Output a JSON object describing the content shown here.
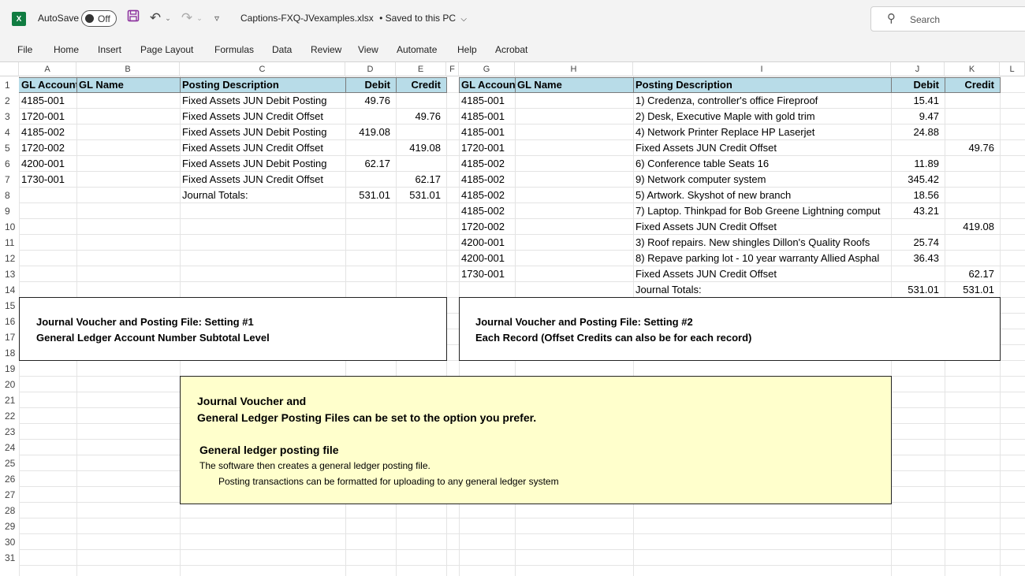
{
  "titlebar": {
    "logo": "X",
    "autosave_label": "AutoSave",
    "autosave_state": "Off",
    "doc_title": "Captions-FXQ-JVexamples.xlsx",
    "save_status": "•  Saved to this PC",
    "search_placeholder": "Search",
    "icons": [
      "excel-logo-icon",
      "save-icon",
      "undo-icon",
      "redo-icon",
      "customize-icon",
      "search-icon"
    ]
  },
  "ribbon": {
    "tabs": [
      "File",
      "Home",
      "Insert",
      "Page Layout",
      "Formulas",
      "Data",
      "Review",
      "View",
      "Automate",
      "Help",
      "Acrobat"
    ]
  },
  "columns": [
    "A",
    "B",
    "C",
    "D",
    "E",
    "F",
    "G",
    "H",
    "I",
    "J",
    "K",
    "L"
  ],
  "rows": [
    "1",
    "2",
    "3",
    "4",
    "5",
    "6",
    "7",
    "8",
    "9",
    "10",
    "11",
    "12",
    "13",
    "14",
    "15",
    "16",
    "17",
    "18",
    "19",
    "20",
    "21",
    "22",
    "23",
    "24",
    "25",
    "26",
    "27",
    "28",
    "29",
    "30",
    "31"
  ],
  "table1": {
    "headers": [
      "GL Account",
      "GL Name",
      "Posting Description",
      "Debit",
      "Credit"
    ],
    "rows": [
      [
        "4185-001",
        "",
        "Fixed Assets JUN Debit Posting",
        "49.76",
        ""
      ],
      [
        "1720-001",
        "",
        "Fixed Assets JUN Credit Offset",
        "",
        "49.76"
      ],
      [
        "4185-002",
        "",
        "Fixed Assets JUN Debit Posting",
        "419.08",
        ""
      ],
      [
        "1720-002",
        "",
        "Fixed Assets JUN Credit Offset",
        "",
        "419.08"
      ],
      [
        "4200-001",
        "",
        "Fixed Assets JUN Debit Posting",
        "62.17",
        ""
      ],
      [
        "1730-001",
        "",
        "Fixed Assets JUN Credit Offset",
        "",
        "62.17"
      ],
      [
        "",
        "",
        "Journal Totals:",
        "531.01",
        "531.01"
      ]
    ]
  },
  "table2": {
    "headers": [
      "GL Account",
      "GL Name",
      "Posting Description",
      "Debit",
      "Credit"
    ],
    "rows": [
      [
        "4185-001",
        "",
        "1) Credenza, controller's office Fireproof",
        "15.41",
        ""
      ],
      [
        "4185-001",
        "",
        "2) Desk, Executive Maple with gold trim",
        "9.47",
        ""
      ],
      [
        "4185-001",
        "",
        "4) Network Printer Replace HP Laserjet",
        "24.88",
        ""
      ],
      [
        "1720-001",
        "",
        "Fixed Assets JUN Credit Offset",
        "",
        "49.76"
      ],
      [
        "4185-002",
        "",
        "6) Conference table Seats 16",
        "11.89",
        ""
      ],
      [
        "4185-002",
        "",
        "9) Network computer system",
        "345.42",
        ""
      ],
      [
        "4185-002",
        "",
        "5) Artwork. Skyshot of new branch",
        "18.56",
        ""
      ],
      [
        "4185-002",
        "",
        "7) Laptop. Thinkpad for Bob Greene Lightning comput",
        "43.21",
        ""
      ],
      [
        "1720-002",
        "",
        "Fixed Assets JUN Credit Offset",
        "",
        "419.08"
      ],
      [
        "4200-001",
        "",
        "3) Roof repairs. New shingles Dillon's Quality Roofs",
        "25.74",
        ""
      ],
      [
        "4200-001",
        "",
        "8) Repave parking lot - 10 year warranty Allied Asphal",
        "36.43",
        ""
      ],
      [
        "1730-001",
        "",
        "Fixed Assets JUN Credit Offset",
        "",
        "62.17"
      ],
      [
        "",
        "",
        "Journal Totals:",
        "531.01",
        "531.01"
      ]
    ]
  },
  "box1": {
    "line1": "Journal Voucher and Posting File:  Setting #1",
    "line2": "General Ledger Account Number Subtotal Level"
  },
  "box2": {
    "line1": "Journal Voucher and Posting File:  Setting #2",
    "line2": "Each Record  (Offset Credits can also be for each record)"
  },
  "note": {
    "line1": "Journal Voucher and",
    "line2": "General Ledger Posting Files can be set to the option you prefer.",
    "line3": "General ledger posting file",
    "line4": "The software then creates a general ledger posting file.",
    "line5": "Posting transactions can be formatted for uploading to any general ledger system",
    "fill_color": "#ffffcc"
  },
  "colors": {
    "header_fill": "#b8dce8",
    "excel_green": "#107c41"
  }
}
